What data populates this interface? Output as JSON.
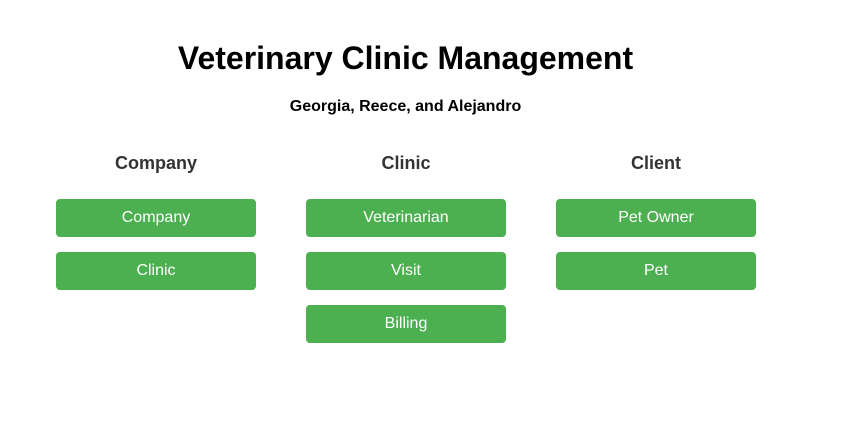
{
  "header": {
    "title": "Veterinary Clinic Management",
    "subtitle": "Georgia, Reece, and Alejandro"
  },
  "columns": [
    {
      "heading": "Company",
      "buttons": [
        "Company",
        "Clinic"
      ]
    },
    {
      "heading": "Clinic",
      "buttons": [
        "Veterinarian",
        "Visit",
        "Billing"
      ]
    },
    {
      "heading": "Client",
      "buttons": [
        "Pet Owner",
        "Pet"
      ]
    }
  ],
  "colors": {
    "button_bg": "#4caf50",
    "button_text": "#ffffff",
    "heading_text": "#333333"
  }
}
